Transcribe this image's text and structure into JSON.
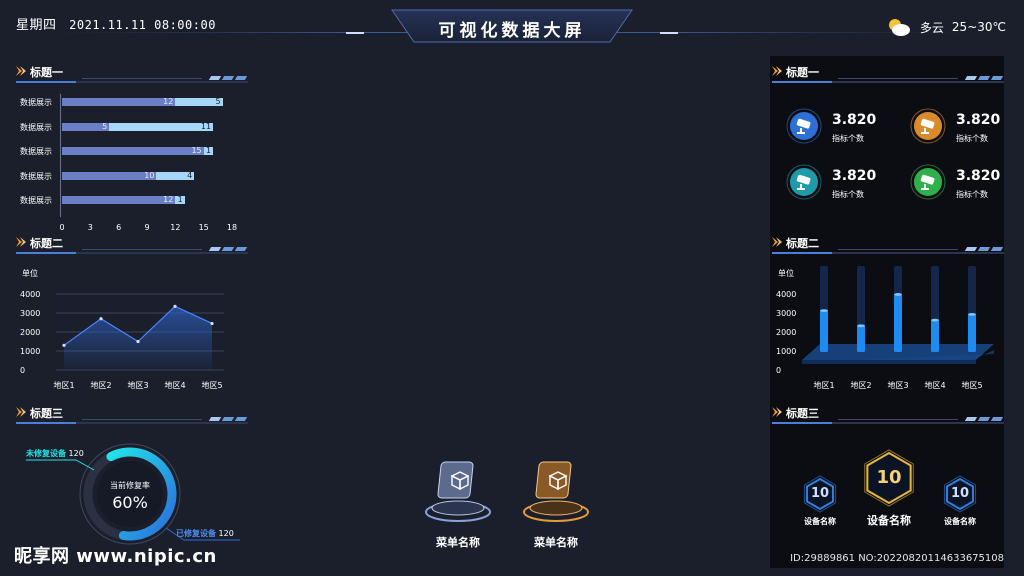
{
  "header": {
    "weekday": "星期四",
    "datetime": "2021.11.11 08:00:00",
    "title": "可视化数据大屏",
    "weather": {
      "condition": "多云",
      "temp_range": "25~30℃",
      "icon": "partly-cloudy-icon"
    }
  },
  "left": {
    "s1": {
      "title": "标题一",
      "chart_data": {
        "type": "bar",
        "orientation": "horizontal",
        "stacked": true,
        "categories": [
          "数据展示",
          "数据展示",
          "数据展示",
          "数据展示",
          "数据展示"
        ],
        "series": [
          {
            "values": [
              12,
              5,
              15,
              10,
              12
            ],
            "color": "#6a7fc6"
          },
          {
            "values": [
              5,
              11,
              1,
              4,
              1
            ],
            "color": "#a7d7f8"
          }
        ],
        "xticks": [
          "0",
          "3",
          "6",
          "9",
          "12",
          "15",
          "18"
        ],
        "xlim": [
          0,
          18
        ]
      }
    },
    "s2": {
      "title": "标题二",
      "chart_data": {
        "type": "area",
        "ylabel": "单位",
        "categories": [
          "地区1",
          "地区2",
          "地区3",
          "地区4",
          "地区5"
        ],
        "values": [
          1300,
          2700,
          1500,
          3350,
          2450
        ],
        "yticks": [
          "4000",
          "3000",
          "2000",
          "1000",
          "0"
        ],
        "ylim": [
          0,
          4000
        ],
        "color": "#2f62c8"
      }
    },
    "s3": {
      "title": "标题三",
      "unrepaired_label": "未修复设备",
      "unrepaired_value": "120",
      "repaired_label": "已修复设备",
      "repaired_value": "120",
      "center_label": "当前修复率",
      "center_value": "60%",
      "rate": 0.6
    }
  },
  "center": {
    "menus": [
      {
        "label": "菜单名称",
        "icon": "cube-icon",
        "theme": "silver"
      },
      {
        "label": "菜单名称",
        "icon": "cube-icon",
        "theme": "gold"
      }
    ]
  },
  "right": {
    "s1": {
      "title": "标题一",
      "metrics": [
        {
          "value": "3.820",
          "label": "指标个数",
          "color": "#2e6fd6",
          "icon": "camera-icon"
        },
        {
          "value": "3.820",
          "label": "指标个数",
          "color": "#d98a2a",
          "icon": "camera-icon"
        },
        {
          "value": "3.820",
          "label": "指标个数",
          "color": "#1e9aa8",
          "icon": "camera-icon"
        },
        {
          "value": "3.820",
          "label": "指标个数",
          "color": "#2fb04a",
          "icon": "camera-icon"
        }
      ]
    },
    "s2": {
      "title": "标题二",
      "chart_data": {
        "type": "bar",
        "ylabel": "单位",
        "categories": [
          "地区1",
          "地区2",
          "地区3",
          "地区4",
          "地区5"
        ],
        "values": [
          2600,
          1800,
          3450,
          2100,
          2400
        ],
        "yticks": [
          "4000",
          "3000",
          "2000",
          "1000",
          "0"
        ],
        "ylim": [
          0,
          4000
        ],
        "color": "#1f8bf0"
      }
    },
    "s3": {
      "title": "标题三",
      "devices": [
        {
          "value": "10",
          "label": "设备名称",
          "color": "#2f7fe0"
        },
        {
          "value": "10",
          "label": "设备名称",
          "color": "#e6b83a"
        },
        {
          "value": "10",
          "label": "设备名称",
          "color": "#2f7fe0"
        }
      ]
    }
  },
  "watermark": {
    "brand": "昵享网 www.nipic.cn",
    "id": "ID:29889861 NO:20220820114633675108"
  }
}
